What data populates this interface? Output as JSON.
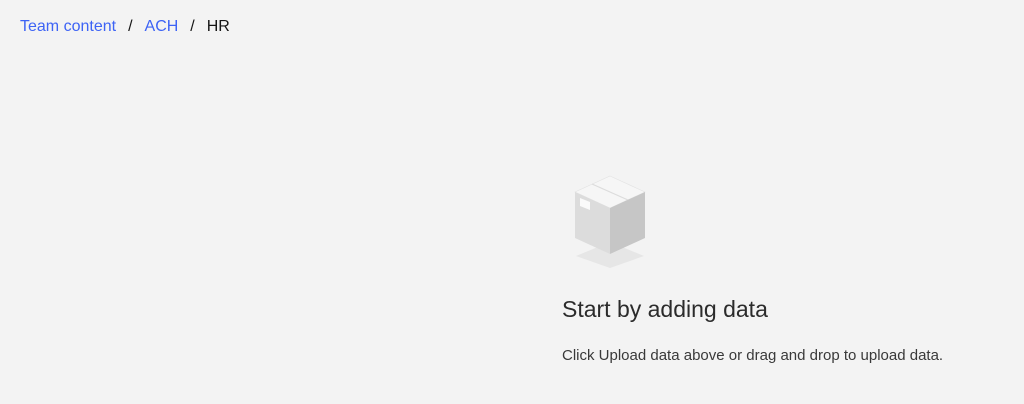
{
  "breadcrumb": {
    "items": [
      {
        "label": "Team content"
      },
      {
        "label": "ACH"
      }
    ],
    "separator": "/",
    "current": "HR"
  },
  "empty_state": {
    "icon": "box-icon",
    "title": "Start by adding data",
    "description": "Click Upload data above or drag and drop to upload data."
  },
  "colors": {
    "background": "#f3f3f3",
    "link": "#3d63f5",
    "text": "#161616"
  }
}
